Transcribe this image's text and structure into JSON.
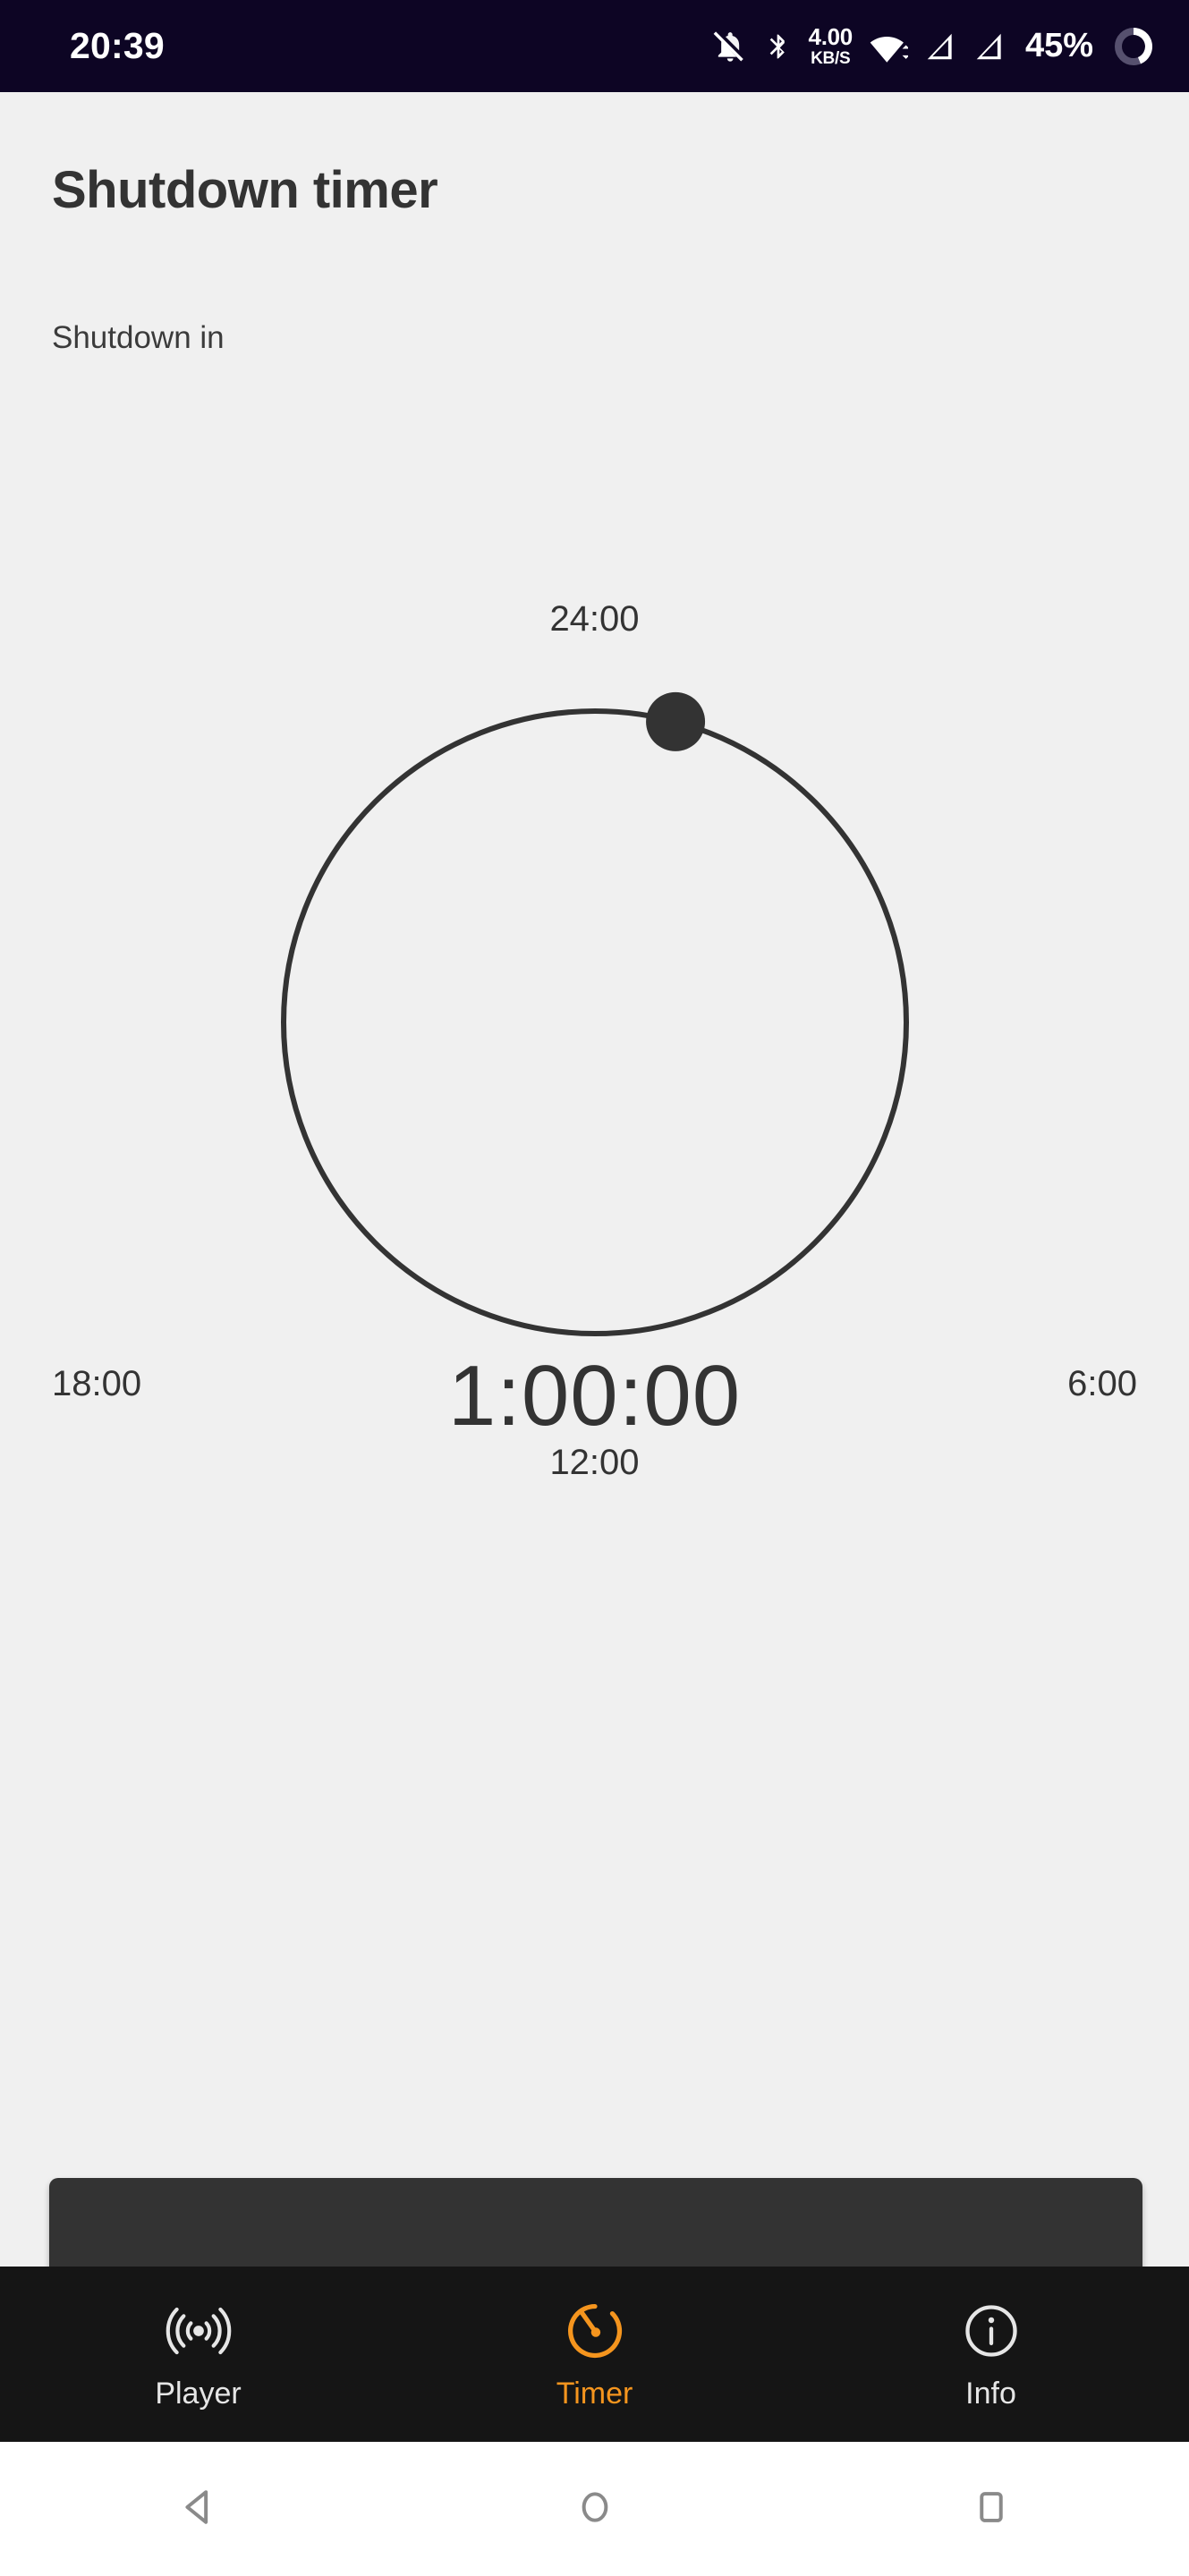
{
  "status_bar": {
    "clock": "20:39",
    "background_color": "#0d0524",
    "icons": [
      {
        "name": "silent-mode-icon",
        "label": "notifications-off"
      },
      {
        "name": "bluetooth-icon",
        "label": "bluetooth"
      },
      {
        "name": "wifi-icon",
        "label": "wifi"
      },
      {
        "name": "signal-sim1-icon",
        "label": "cellular-signal-1"
      },
      {
        "name": "signal-sim2-icon",
        "label": "cellular-signal-2"
      },
      {
        "name": "battery-ring-icon",
        "label": "battery-circle"
      }
    ],
    "network_speed_value": "4.00",
    "network_speed_unit": "KB/S",
    "battery_percent": "45%",
    "battery_level": 45
  },
  "header": {
    "title": "Shutdown timer",
    "subtitle": "Shutdown in"
  },
  "dial": {
    "label_top": "24:00",
    "label_right": "6:00",
    "label_bottom": "12:00",
    "label_left": "18:00",
    "center_time": "1:00:00",
    "handle_angle_degrees": 15,
    "selected_hours": 1,
    "max_hours": 24,
    "ring_color": "#333333",
    "handle_color": "#333333"
  },
  "action_bar": {
    "label": "",
    "background_color": "#333333"
  },
  "bottom_nav": {
    "active_color": "#f5951e",
    "inactive_color": "#e6e6e6",
    "background_color": "#151515",
    "items": [
      {
        "label": "Player",
        "icon": "broadcast-icon",
        "active": false
      },
      {
        "label": "Timer",
        "icon": "timer-icon",
        "active": true
      },
      {
        "label": "Info",
        "icon": "info-circle-icon",
        "active": false
      }
    ]
  },
  "system_nav": {
    "buttons": [
      {
        "name": "back-button",
        "icon": "triangle-back-icon"
      },
      {
        "name": "home-button",
        "icon": "circle-home-icon"
      },
      {
        "name": "recents-button",
        "icon": "square-recents-icon"
      }
    ]
  }
}
